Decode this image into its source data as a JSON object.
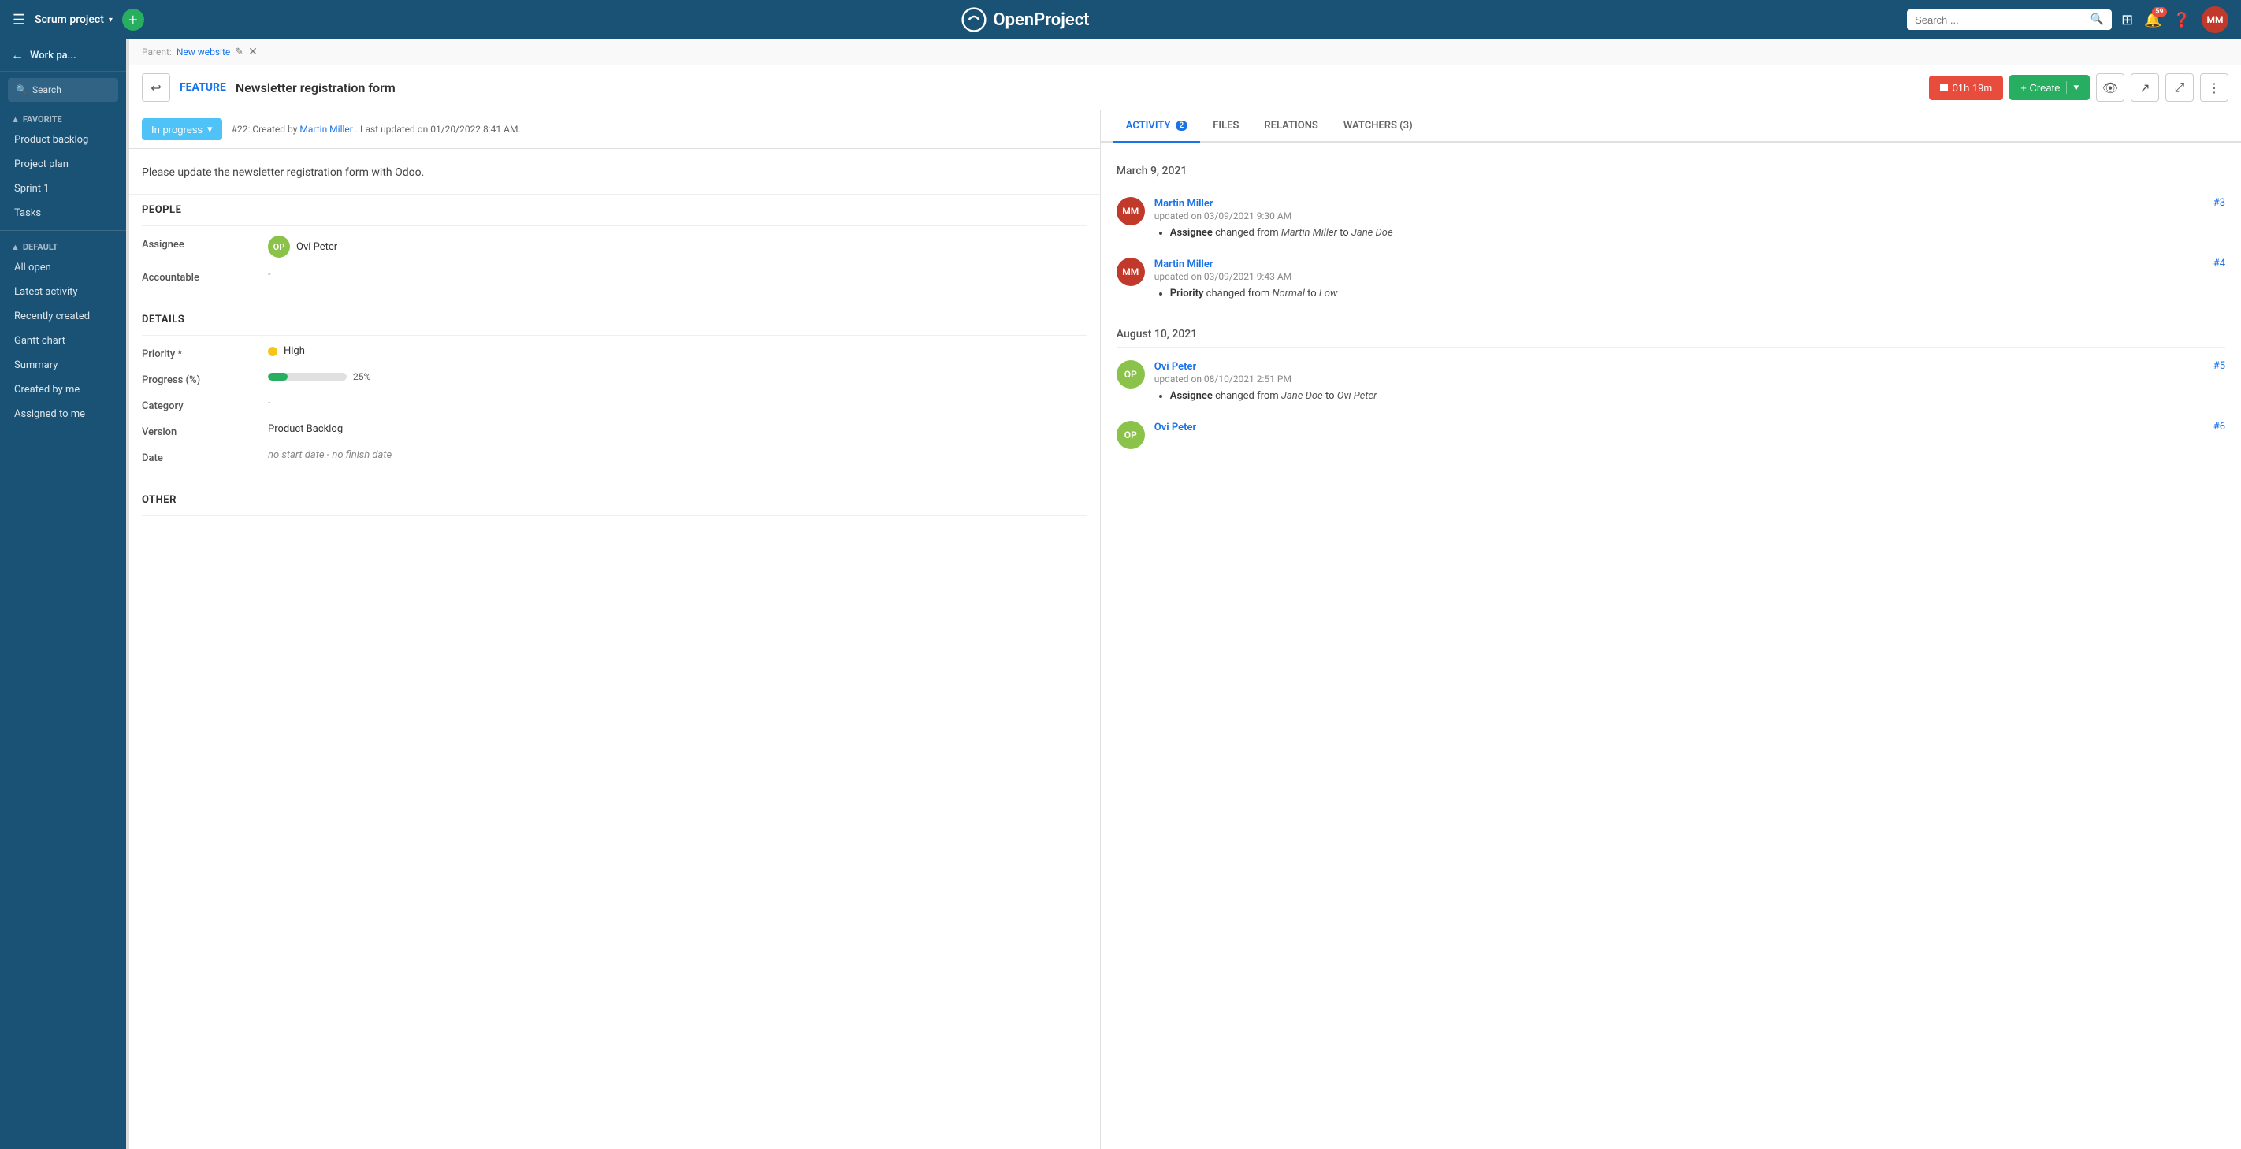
{
  "topnav": {
    "hamburger": "☰",
    "project_name": "Scrum project",
    "project_chevron": "▾",
    "add_button": "+",
    "logo_text": "OpenProject",
    "search_placeholder": "Search ...",
    "notification_count": "59",
    "avatar_initials": "MM"
  },
  "sidebar": {
    "back_arrow": "←",
    "title": "Work pa...",
    "search_label": "Search",
    "sections": [
      {
        "label": "FAVORITE",
        "caret": "▲",
        "items": [
          {
            "id": "product-backlog",
            "label": "Product backlog",
            "active": false
          },
          {
            "id": "project-plan",
            "label": "Project plan",
            "active": false
          },
          {
            "id": "sprint-1",
            "label": "Sprint 1",
            "active": false
          },
          {
            "id": "tasks",
            "label": "Tasks",
            "active": false
          }
        ]
      },
      {
        "label": "DEFAULT",
        "caret": "▲",
        "items": [
          {
            "id": "all-open",
            "label": "All open",
            "active": false
          },
          {
            "id": "latest-activity",
            "label": "Latest activity",
            "active": false
          },
          {
            "id": "recently-created",
            "label": "Recently created",
            "active": false
          },
          {
            "id": "gantt-chart",
            "label": "Gantt chart",
            "active": false
          },
          {
            "id": "summary",
            "label": "Summary",
            "active": false
          },
          {
            "id": "created-by-me",
            "label": "Created by me",
            "active": false
          },
          {
            "id": "assigned-to-me",
            "label": "Assigned to me",
            "active": false
          }
        ]
      }
    ]
  },
  "breadcrumb": {
    "parent_label": "Parent:",
    "parent_link": "New website",
    "edit_icon": "✎",
    "close_icon": "✕"
  },
  "wp_header": {
    "back_arrow": "↩",
    "type": "FEATURE",
    "title": "Newsletter registration form",
    "timer_label": "01h 19m",
    "create_label": "+ Create",
    "create_chevron": "▾"
  },
  "status_bar": {
    "status": "In progress",
    "status_chevron": "▾",
    "info": "#22: Created by",
    "creator": "Martin Miller",
    "info2": ". Last updated on 01/20/2022 8:41 AM."
  },
  "description": {
    "text": "Please update the newsletter registration form with Odoo."
  },
  "people_section": {
    "title": "PEOPLE",
    "assignee_label": "Assignee",
    "assignee_avatar": "OP",
    "assignee_name": "Ovi Peter",
    "accountable_label": "Accountable",
    "accountable_value": "-"
  },
  "details_section": {
    "title": "DETAILS",
    "priority_label": "Priority *",
    "priority_value": "High",
    "progress_label": "Progress (%)",
    "progress_percent": 25,
    "progress_text": "25%",
    "category_label": "Category",
    "category_value": "-",
    "version_label": "Version",
    "version_value": "Product Backlog",
    "date_label": "Date",
    "date_value": "no start date - no finish date"
  },
  "other_section": {
    "title": "OTHER"
  },
  "tabs": [
    {
      "id": "activity",
      "label": "ACTIVITY",
      "badge": "2",
      "active": true
    },
    {
      "id": "files",
      "label": "FILES",
      "badge": null,
      "active": false
    },
    {
      "id": "relations",
      "label": "RELATIONS",
      "badge": null,
      "active": false
    },
    {
      "id": "watchers",
      "label": "WATCHERS (3)",
      "badge": null,
      "active": false
    }
  ],
  "activity": {
    "dates": [
      {
        "date": "March 9, 2021",
        "entries": [
          {
            "id": "#3",
            "avatar_initials": "MM",
            "avatar_class": "mm",
            "name": "Martin Miller",
            "updated": "updated on 03/09/2021 9:30 AM",
            "changes": [
              {
                "field": "Assignee",
                "from": "Martin Miller",
                "to": "Jane Doe"
              }
            ]
          },
          {
            "id": "#4",
            "avatar_initials": "MM",
            "avatar_class": "mm",
            "name": "Martin Miller",
            "updated": "updated on 03/09/2021 9:43 AM",
            "changes": [
              {
                "field": "Priority",
                "from": "Normal",
                "to": "Low"
              }
            ]
          }
        ]
      },
      {
        "date": "August 10, 2021",
        "entries": [
          {
            "id": "#5",
            "avatar_initials": "OP",
            "avatar_class": "op",
            "name": "Ovi Peter",
            "updated": "updated on 08/10/2021 2:51 PM",
            "changes": [
              {
                "field": "Assignee",
                "from": "Jane Doe",
                "to": "Ovi Peter"
              }
            ]
          },
          {
            "id": "#6",
            "avatar_initials": "OP",
            "avatar_class": "op",
            "name": "Ovi Peter",
            "updated": "",
            "changes": []
          }
        ]
      }
    ]
  }
}
